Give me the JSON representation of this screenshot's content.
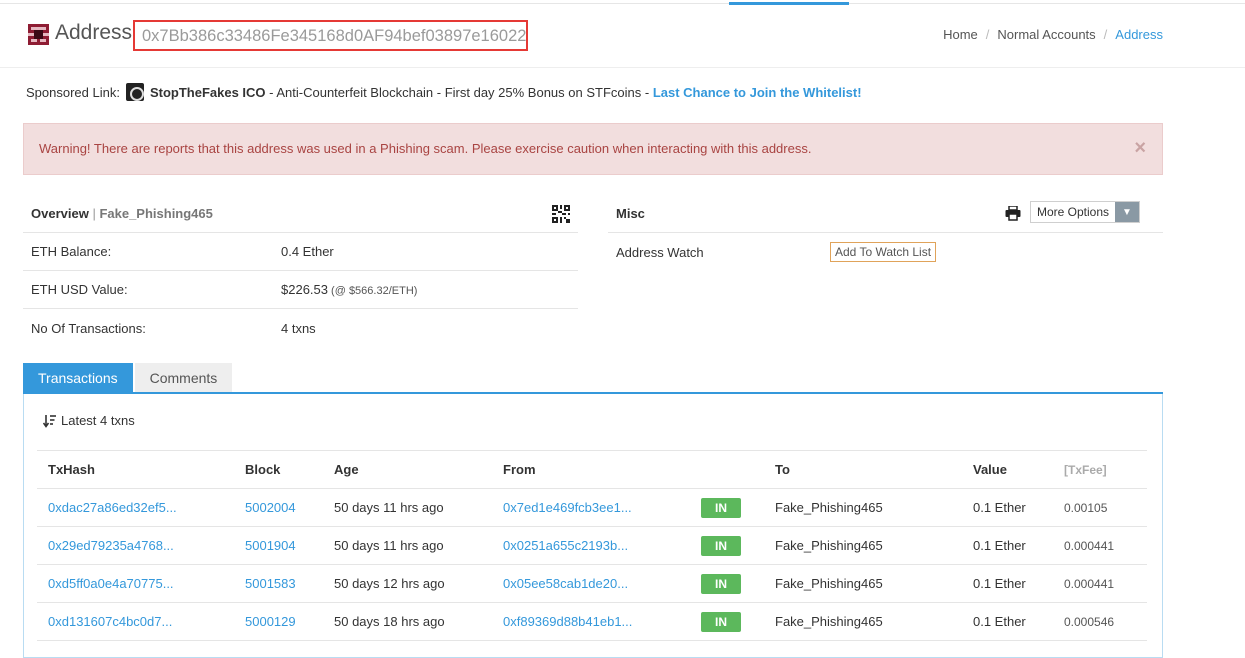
{
  "header": {
    "title": "Address",
    "address": "0x7Bb386c33486Fe345168d0AF94bef03897e16022"
  },
  "breadcrumb": [
    "Home",
    "Normal Accounts",
    "Address"
  ],
  "sponsored": {
    "label": "Sponsored Link:",
    "name": "StopTheFakes ICO",
    "text": " - Anti-Counterfeit Blockchain - First day 25% Bonus on STFcoins - ",
    "cta": "Last Chance to Join the Whitelist!"
  },
  "alert": {
    "message": "Warning! There are reports that this address was used in a Phishing scam. Please exercise caution when interacting with this address.",
    "close": "×"
  },
  "overview": {
    "title": "Overview",
    "separator": " | ",
    "tag": "Fake_Phishing465",
    "rows": [
      {
        "label": "ETH Balance:",
        "value": "0.4 Ether",
        "extra": ""
      },
      {
        "label": "ETH USD Value:",
        "value": "$226.53",
        "extra": " (@ $566.32/ETH)"
      },
      {
        "label": "No Of Transactions:",
        "value": "4 txns",
        "extra": ""
      }
    ]
  },
  "misc": {
    "title": "Misc",
    "more_options": "More Options",
    "watch_label": "Address Watch",
    "watch_button": "Add To Watch List"
  },
  "tabs": [
    "Transactions",
    "Comments"
  ],
  "transactions": {
    "latest": "Latest 4 txns",
    "columns": [
      "TxHash",
      "Block",
      "Age",
      "From",
      "",
      "To",
      "Value",
      "[TxFee]"
    ],
    "rows": [
      {
        "hash": "0xdac27a86ed32ef5...",
        "block": "5002004",
        "age": "50 days 11 hrs ago",
        "from": "0x7ed1e469fcb3ee1...",
        "dir": "IN",
        "to": "Fake_Phishing465",
        "value": "0.1 Ether",
        "fee": "0.00105"
      },
      {
        "hash": "0x29ed79235a4768...",
        "block": "5001904",
        "age": "50 days 11 hrs ago",
        "from": "0x0251a655c2193b...",
        "dir": "IN",
        "to": "Fake_Phishing465",
        "value": "0.1 Ether",
        "fee": "0.000441"
      },
      {
        "hash": "0xd5ff0a0e4a70775...",
        "block": "5001583",
        "age": "50 days 12 hrs ago",
        "from": "0x05ee58cab1de20...",
        "dir": "IN",
        "to": "Fake_Phishing465",
        "value": "0.1 Ether",
        "fee": "0.000441"
      },
      {
        "hash": "0xd131607c4bc0d7...",
        "block": "5000129",
        "age": "50 days 18 hrs ago",
        "from": "0xf89369d88b41eb1...",
        "dir": "IN",
        "to": "Fake_Phishing465",
        "value": "0.1 Ether",
        "fee": "0.000546"
      }
    ]
  },
  "colors": {
    "accent": "#3498db",
    "alert_bg": "#f2dede",
    "alert_text": "#a94442",
    "in_badge": "#5cb85c",
    "highlight_border": "#e53935"
  },
  "icons": {
    "avatar": "identicon-avatar",
    "qr": "qr-code-icon",
    "print": "printer-icon",
    "sort": "sort-icon",
    "caret": "caret-down-icon"
  }
}
